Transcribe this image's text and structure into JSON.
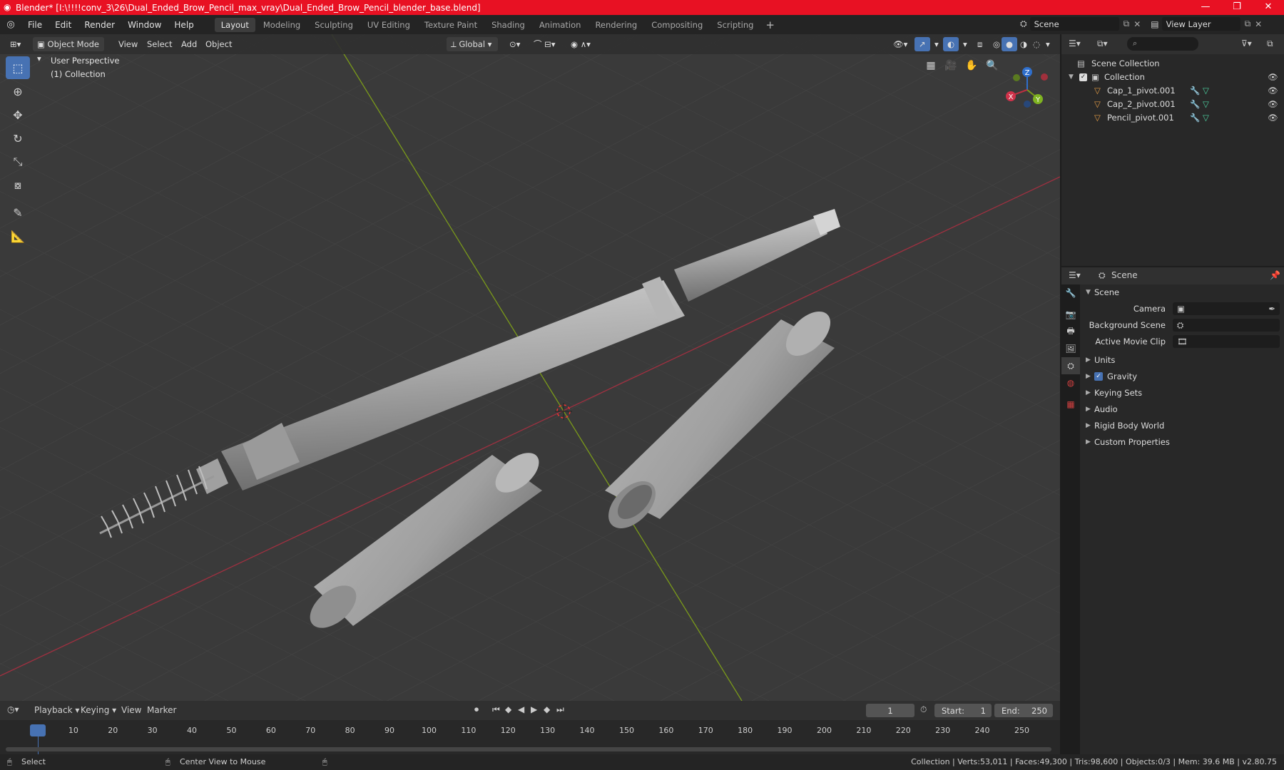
{
  "window": {
    "title": "Blender* [I:\\!!!!conv_3\\26\\Dual_Ended_Brow_Pencil_max_vray\\Dual_Ended_Brow_Pencil_blender_base.blend]",
    "minimize": "—",
    "maximize": "❐",
    "close": "✕"
  },
  "menu": [
    "File",
    "Edit",
    "Render",
    "Window",
    "Help"
  ],
  "workspaces": [
    "Layout",
    "Modeling",
    "Sculpting",
    "UV Editing",
    "Texture Paint",
    "Shading",
    "Animation",
    "Rendering",
    "Compositing",
    "Scripting"
  ],
  "active_workspace": "Layout",
  "scene_field": "Scene",
  "view_layer_field": "View Layer",
  "viewport": {
    "mode": "Object Mode",
    "menus": [
      "View",
      "Select",
      "Add",
      "Object"
    ],
    "orientation": "Global",
    "overlay_line1": "User Perspective",
    "overlay_line2": "(1) Collection",
    "gizmo": {
      "x": "X",
      "y": "Y",
      "z": "Z"
    }
  },
  "outliner": {
    "scene_collection": "Scene Collection",
    "collection": "Collection",
    "objects": [
      "Cap_1_pivot.001",
      "Cap_2_pivot.001",
      "Pencil_pivot.001"
    ]
  },
  "properties": {
    "header": "Scene",
    "section": "Scene",
    "fields": [
      {
        "label": "Camera",
        "value": ""
      },
      {
        "label": "Background Scene",
        "value": ""
      },
      {
        "label": "Active Movie Clip",
        "value": ""
      }
    ],
    "panels": [
      "Units",
      "Gravity",
      "Keying Sets",
      "Audio",
      "Rigid Body World",
      "Custom Properties"
    ],
    "gravity_checked": true
  },
  "timeline": {
    "menus": [
      "Playback",
      "Keying",
      "View",
      "Marker"
    ],
    "current_frame": "1",
    "start_label": "Start:",
    "start": "1",
    "end_label": "End:",
    "end": "250",
    "ticks": [
      "1",
      "10",
      "20",
      "30",
      "40",
      "50",
      "60",
      "70",
      "80",
      "90",
      "100",
      "110",
      "120",
      "130",
      "140",
      "150",
      "160",
      "170",
      "180",
      "190",
      "200",
      "210",
      "220",
      "230",
      "240",
      "250"
    ]
  },
  "status": {
    "left1": "Select",
    "left2": "Center View to Mouse",
    "right": "Collection | Verts:53,011 | Faces:49,300 | Tris:98,600 | Objects:0/3 | Mem: 39.6 MB | v2.80.75"
  },
  "colors": {
    "accent": "#4772b3",
    "title_bar": "#e81123",
    "x_axis": "#b0323f",
    "y_axis": "#7a9a1a"
  }
}
